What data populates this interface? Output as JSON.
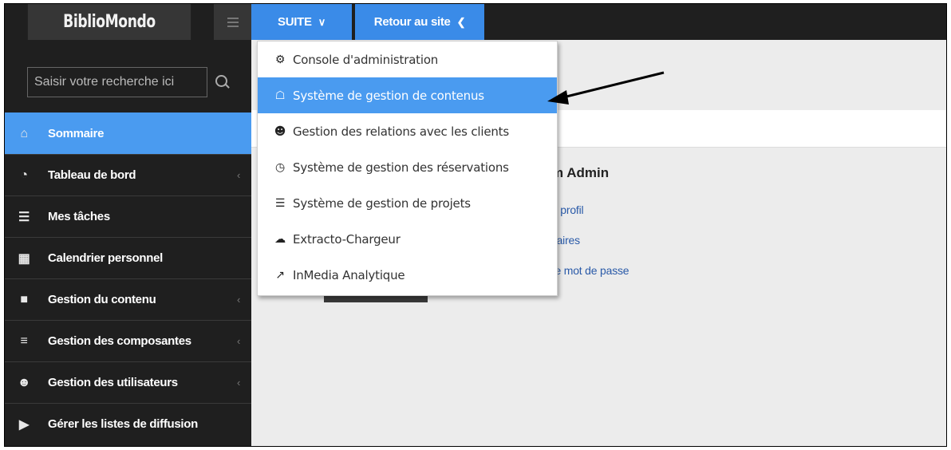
{
  "sidebar": {
    "brand": "BiblioMondo",
    "search_placeholder": "Saisir votre recherche ici",
    "items": [
      {
        "label": "Sommaire",
        "icon": "home-icon",
        "glyph": "⌂",
        "active": true,
        "caret": false
      },
      {
        "label": "Tableau de bord",
        "icon": "dashboard-icon",
        "glyph": "◔",
        "active": false,
        "caret": true
      },
      {
        "label": "Mes tâches",
        "icon": "tasks-icon",
        "glyph": "☰",
        "active": false,
        "caret": false
      },
      {
        "label": "Calendrier personnel",
        "icon": "calendar-icon",
        "glyph": "▦",
        "active": false,
        "caret": false
      },
      {
        "label": "Gestion du contenu",
        "icon": "file-icon",
        "glyph": "■",
        "active": false,
        "caret": true
      },
      {
        "label": "Gestion des composantes",
        "icon": "file-text-icon",
        "glyph": "≡",
        "active": false,
        "caret": true
      },
      {
        "label": "Gestion des utilisateurs",
        "icon": "users-icon",
        "glyph": "☻",
        "active": false,
        "caret": true
      },
      {
        "label": "Gérer les listes de diffusion",
        "icon": "video-icon",
        "glyph": "▶",
        "active": false,
        "caret": false
      }
    ]
  },
  "topbar": {
    "suite_label": "SUITE",
    "suite_chevron": "✔",
    "retour_label": "Retour au site",
    "retour_chevron": "❮"
  },
  "main": {
    "greeting": "m Admin",
    "links": [
      "e profil",
      "itaires",
      "re mot de passe"
    ]
  },
  "dropdown": {
    "items": [
      {
        "label": "Console d'administration",
        "icon": "cogs-icon",
        "glyph": "⚙",
        "selected": false
      },
      {
        "label": "Système de gestion de contenus",
        "icon": "sitemap-icon",
        "glyph": "☖",
        "selected": true
      },
      {
        "label": "Gestion des relations avec les clients",
        "icon": "users-icon",
        "glyph": "☻",
        "selected": false
      },
      {
        "label": "Système de gestion des réservations",
        "icon": "clock-icon",
        "glyph": "◷",
        "selected": false
      },
      {
        "label": "Système de gestion de projets",
        "icon": "tasks-icon",
        "glyph": "☰",
        "selected": false
      },
      {
        "label": "Extracto-Chargeur",
        "icon": "cloud-icon",
        "glyph": "☁",
        "selected": false
      },
      {
        "label": "InMedia Analytique",
        "icon": "line-chart-icon",
        "glyph": "↗",
        "selected": false
      }
    ]
  },
  "colors": {
    "accent": "#4a9bf0",
    "sidebar_bg": "#1f1f1f",
    "link": "#2a5aa8"
  }
}
